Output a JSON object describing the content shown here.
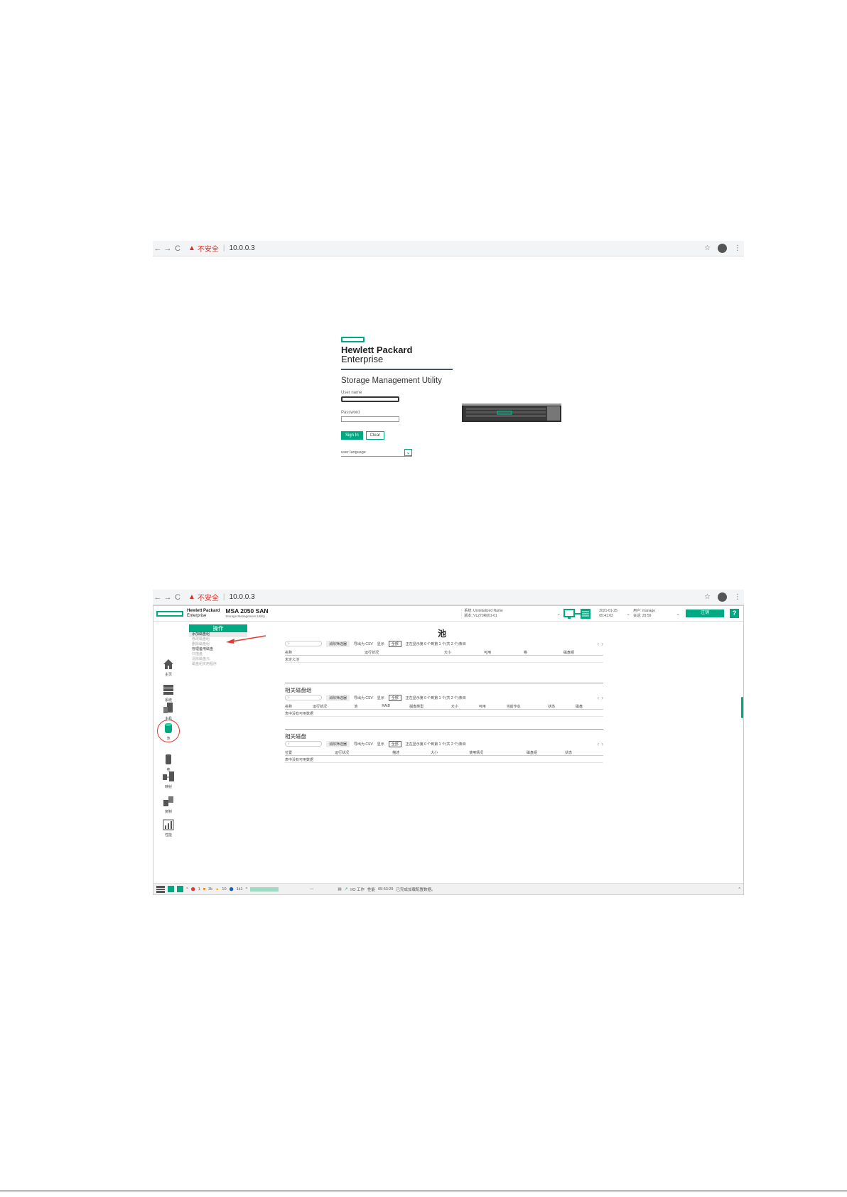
{
  "browser1": {
    "warning": "不安全",
    "url": "10.0.0.3"
  },
  "browser2": {
    "warning": "不安全",
    "url": "10.0.0.3"
  },
  "login": {
    "brand_line1": "Hewlett Packard",
    "brand_line2": "Enterprise",
    "utility_title": "Storage Management Utility",
    "username_label": "User name",
    "password_label": "Password",
    "signin_label": "Sign In",
    "clear_label": "Clear",
    "language_placeholder": "user language"
  },
  "app": {
    "brand_line1": "Hewlett Packard",
    "brand_line2": "Enterprise",
    "product": "MSA 2050 SAN",
    "product_sub": "Storage Management Utility",
    "system_line1": "系统: Uninitialized Name",
    "system_line2": "版本: VL270R001-01",
    "date": "2021-01-25",
    "time": "05:41:03",
    "user_line1": "用户: manage",
    "user_line2": "会话: 29:59",
    "signout_label": "注销",
    "help_label": "?"
  },
  "sidebar": [
    {
      "label": "主页",
      "icon": "home-icon"
    },
    {
      "label": "系统",
      "icon": "system-icon"
    },
    {
      "label": "主机",
      "icon": "hosts-icon"
    },
    {
      "label": "池",
      "icon": "pools-icon"
    },
    {
      "label": "卷",
      "icon": "volumes-icon"
    },
    {
      "label": "映射",
      "icon": "mapping-icon"
    },
    {
      "label": "复制",
      "icon": "replication-icon"
    },
    {
      "label": "性能",
      "icon": "performance-icon"
    }
  ],
  "menu": {
    "title": "操作",
    "items": [
      "添加磁盘组",
      "修改磁盘组",
      "删除磁盘组",
      "管理备用磁盘",
      "扫描盘",
      "清除磁盘元",
      "磁盘组实用程序"
    ]
  },
  "page_title": "池",
  "pools_section": {
    "search_placeholder": "",
    "clear_filter": "消除筛选器",
    "export_csv": "导出为 CSV",
    "show_label": "显示",
    "show_value": "全部",
    "summary": "正在显示第 0 个到第 1 个(共 2 个)条目",
    "columns": [
      "名称",
      "运行状况",
      "大小",
      "可用",
      "卷",
      "磁盘组"
    ],
    "row": "未定义池"
  },
  "diskgroups_section": {
    "title": "相关磁盘组",
    "clear_filter": "消除筛选器",
    "export_csv": "导出为 CSV",
    "show_label": "显示",
    "show_value": "全部",
    "summary": "正在显示第 0 个到第 1 个(共 2 个)条目",
    "columns": [
      "名称",
      "运行状况",
      "池",
      "RAID",
      "磁盘类型",
      "大小",
      "可用",
      "当前作业",
      "状态",
      "磁盘"
    ],
    "row": "表中没有可用数据"
  },
  "disks_section": {
    "title": "相关磁盘",
    "clear_filter": "消除筛选器",
    "export_csv": "导出为 CSV",
    "show_label": "显示",
    "show_value": "全部",
    "summary": "正在显示第 0 个到第 1 个(共 2 个)条目",
    "columns": [
      "位置",
      "运行状况",
      "描述",
      "大小",
      "使用情况",
      "磁盘组",
      "状态"
    ],
    "row": "表中没有可用数据"
  },
  "statusbar": {
    "counts": [
      "1",
      "3k",
      "10",
      "1k1"
    ],
    "io_label": "I/O 工作",
    "perf_label": "性能",
    "message_time": "05:53:29",
    "message": "已完成加载配置数据。"
  }
}
